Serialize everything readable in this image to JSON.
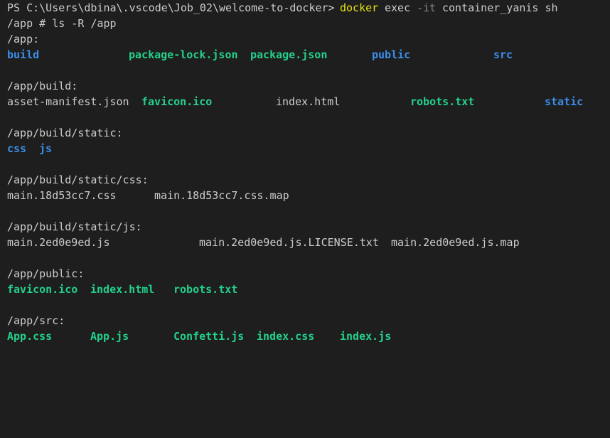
{
  "terminal": {
    "colors": {
      "background": "#1e1e1e",
      "text": "#cccccc",
      "directory": "#3b8eea",
      "green_file": "#23d18b",
      "command": "#e5e510",
      "flag": "#858585"
    },
    "line1": {
      "ps_prompt": "PS C:\\Users\\dbina\\.vscode\\Job_02\\welcome-to-docker>",
      "command": "docker",
      "sub": "exec",
      "flag": "-it",
      "args": "container_yanis sh"
    },
    "line2": "/app # ls -R /app",
    "app": {
      "header": "/app:",
      "items": [
        "build",
        "package-lock.json",
        "package.json",
        "public",
        "src"
      ]
    },
    "build": {
      "header": "/app/build:",
      "items": [
        "asset-manifest.json",
        "favicon.ico",
        "index.html",
        "robots.txt",
        "static"
      ]
    },
    "static": {
      "header": "/app/build/static:",
      "items": [
        "css",
        "js"
      ]
    },
    "css": {
      "header": "/app/build/static/css:",
      "items": [
        "main.18d53cc7.css",
        "main.18d53cc7.css.map"
      ]
    },
    "js": {
      "header": "/app/build/static/js:",
      "items": [
        "main.2ed0e9ed.js",
        "main.2ed0e9ed.js.LICENSE.txt",
        "main.2ed0e9ed.js.map"
      ]
    },
    "public": {
      "header": "/app/public:",
      "items": [
        "favicon.ico",
        "index.html",
        "robots.txt"
      ]
    },
    "src": {
      "header": "/app/src:",
      "items": [
        "App.css",
        "App.js",
        "Confetti.js",
        "index.css",
        "index.js"
      ]
    }
  }
}
